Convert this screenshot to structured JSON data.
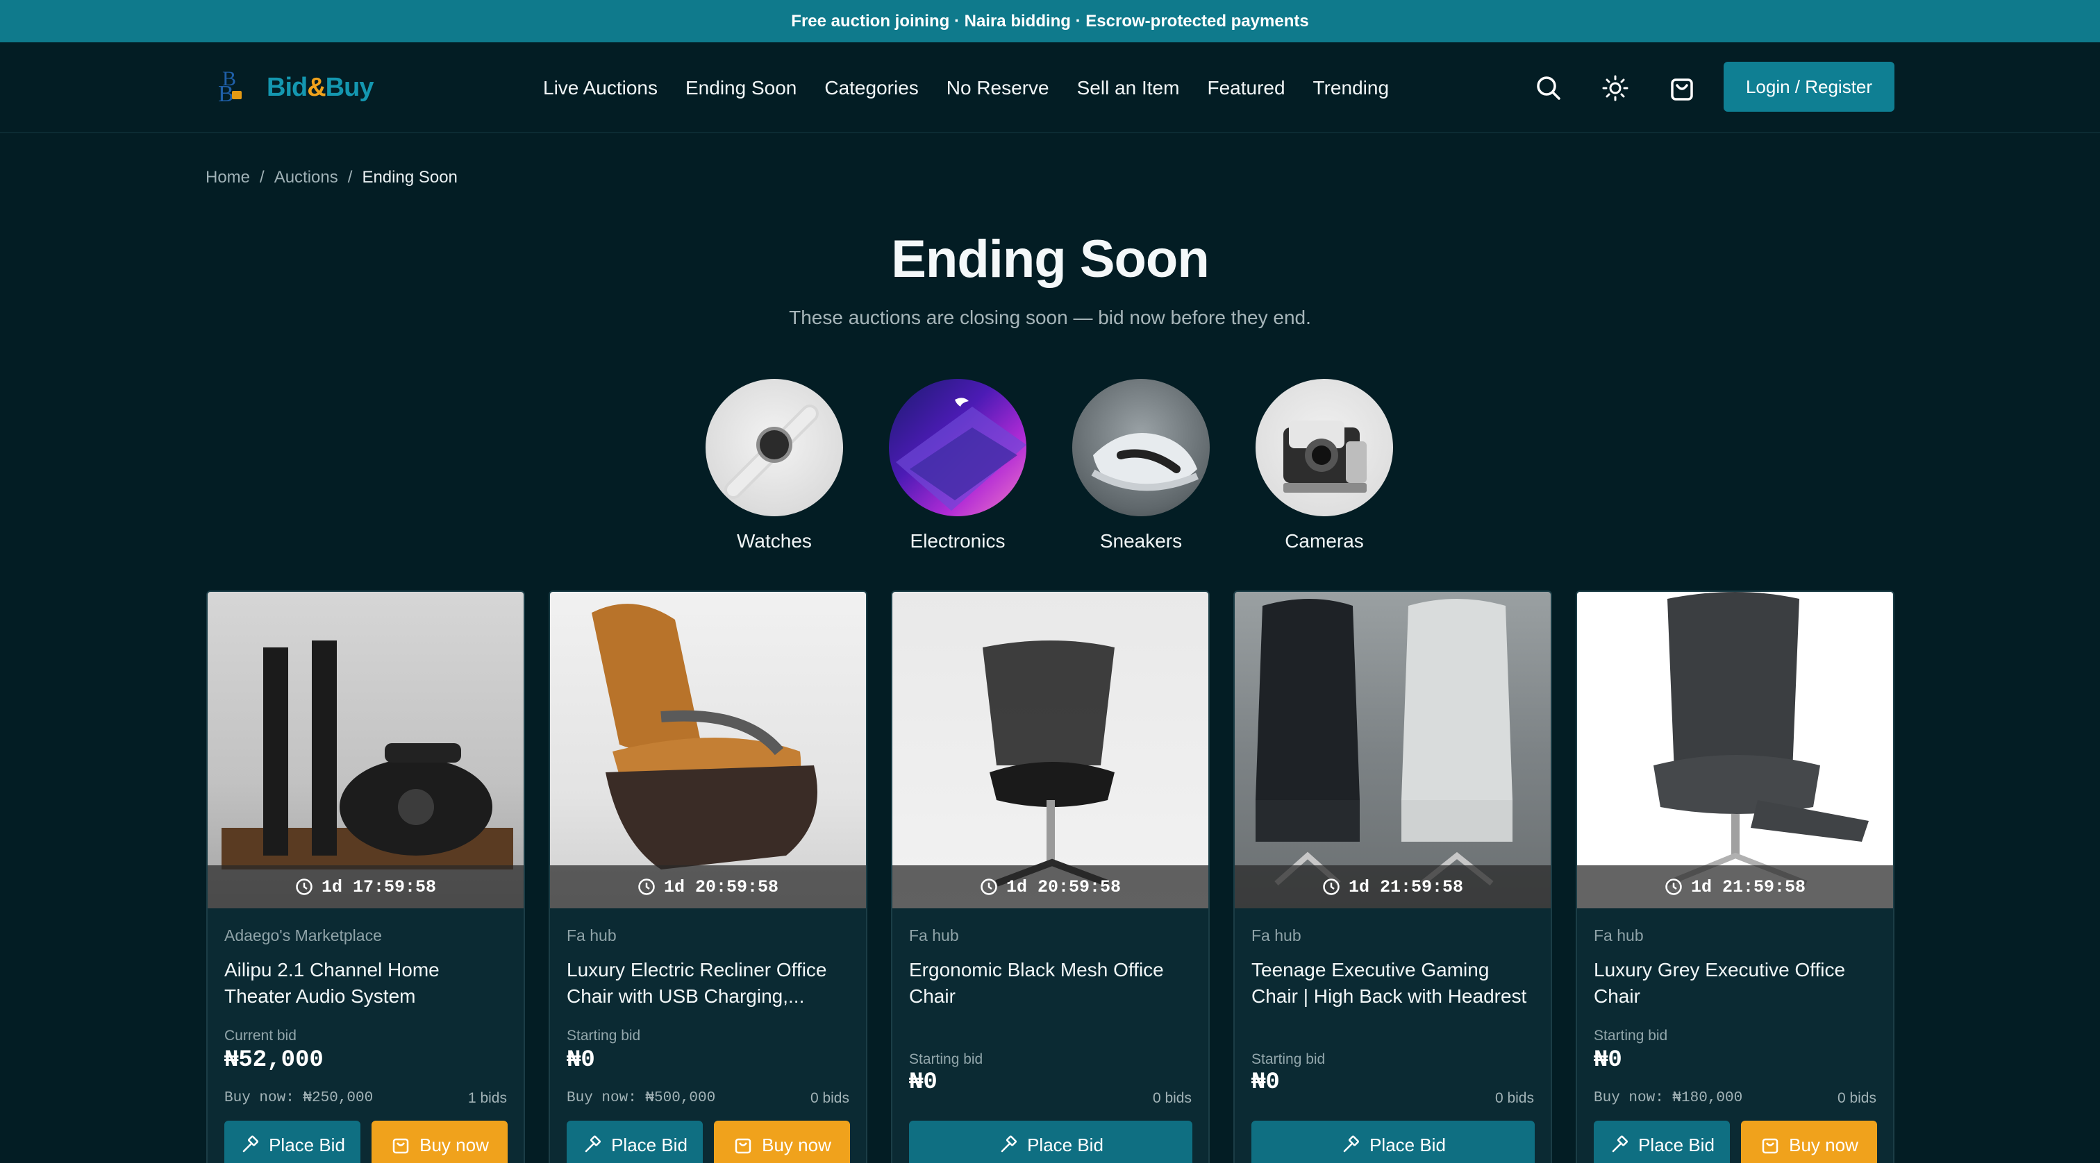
{
  "announcement": "Free auction joining · Naira bidding · Escrow-protected payments",
  "brand": {
    "logo_text_1": "Bid",
    "logo_text_2": "&",
    "logo_text_3": "Buy",
    "colors": {
      "accent": "#0f7a8c",
      "orange": "#f0a21c",
      "bg": "#031d24"
    }
  },
  "nav": [
    "Live Auctions",
    "Ending Soon",
    "Categories",
    "No Reserve",
    "Sell an Item",
    "Featured",
    "Trending"
  ],
  "header_icons": [
    "search-icon",
    "theme-toggle-icon",
    "cart-icon"
  ],
  "login_label": "Login / Register",
  "breadcrumb": {
    "home": "Home",
    "sep": "/",
    "auctions": "Auctions",
    "current": "Ending Soon"
  },
  "page": {
    "title": "Ending Soon",
    "subtitle": "These auctions are closing soon — bid now before they end."
  },
  "categories": [
    {
      "label": "Watches"
    },
    {
      "label": "Electronics"
    },
    {
      "label": "Sneakers"
    },
    {
      "label": "Cameras"
    }
  ],
  "cards": [
    {
      "timer": "1d 17:59:58",
      "seller": "Adaego's Marketplace",
      "title": "Ailipu 2.1 Channel Home Theater Audio System",
      "price_label": "Current bid",
      "price": "₦52,000",
      "buy_now": "Buy now: ₦250,000",
      "bids": "1 bids",
      "bid_label": "Place Bid",
      "buy_label": "Buy now"
    },
    {
      "timer": "1d 20:59:58",
      "seller": "Fa hub",
      "title": "Luxury Electric Recliner Office Chair with USB Charging,...",
      "price_label": "Starting bid",
      "price": "₦0",
      "buy_now": "Buy now: ₦500,000",
      "bids": "0 bids",
      "bid_label": "Place Bid",
      "buy_label": "Buy now"
    },
    {
      "timer": "1d 20:59:58",
      "seller": "Fa hub",
      "title": "Ergonomic Black Mesh Office Chair",
      "price_label": "Starting bid",
      "price": "₦0",
      "bids": "0 bids",
      "bid_label": "Place Bid"
    },
    {
      "timer": "1d 21:59:58",
      "seller": "Fa hub",
      "title": "Teenage Executive Gaming Chair | High Back with Headrest",
      "price_label": "Starting bid",
      "price": "₦0",
      "bids": "0 bids",
      "bid_label": "Place Bid"
    },
    {
      "timer": "1d 21:59:58",
      "seller": "Fa hub",
      "title": "Luxury Grey Executive Office Chair",
      "price_label": "Starting bid",
      "price": "₦0",
      "buy_now": "Buy now: ₦180,000",
      "bids": "0 bids",
      "bid_label": "Place Bid",
      "buy_label": "Buy now"
    }
  ]
}
